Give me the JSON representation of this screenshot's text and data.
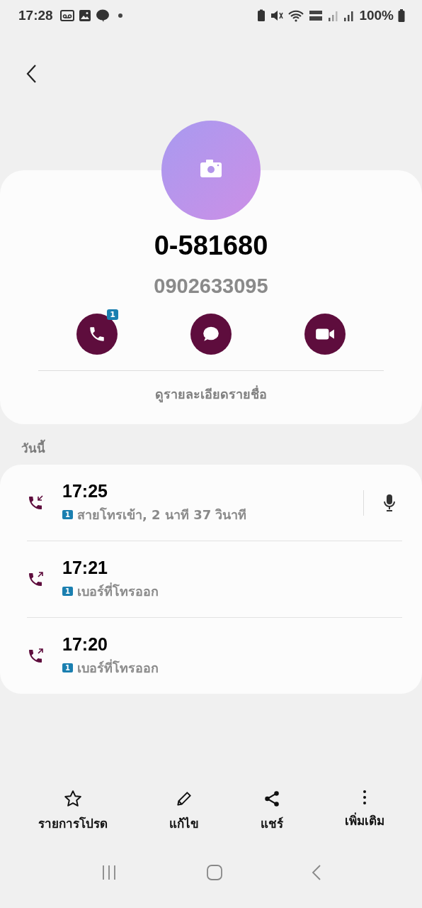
{
  "status_bar": {
    "time": "17:28",
    "battery": "100%"
  },
  "contact": {
    "name": "0-581680",
    "number": "0902633095",
    "missed_badge": "1",
    "details_link": "ดูรายละเอียดรายชื่อ"
  },
  "section_label": "วันนี้",
  "calls": [
    {
      "kind": "incoming",
      "time": "17:25",
      "sim": "1",
      "detail": "สายโทรเข้า, 2 นาที 37 วินาที",
      "recording": true
    },
    {
      "kind": "outgoing",
      "time": "17:21",
      "sim": "1",
      "detail": "เบอร์ที่โทรออก",
      "recording": false
    },
    {
      "kind": "outgoing",
      "time": "17:20",
      "sim": "1",
      "detail": "เบอร์ที่โทรออก",
      "recording": false
    }
  ],
  "actions": [
    {
      "kind": "favorite",
      "label": "รายการโปรด"
    },
    {
      "kind": "edit",
      "label": "แก้ไข"
    },
    {
      "kind": "share",
      "label": "แชร์"
    },
    {
      "kind": "more",
      "label": "เพิ่มเติม"
    }
  ]
}
